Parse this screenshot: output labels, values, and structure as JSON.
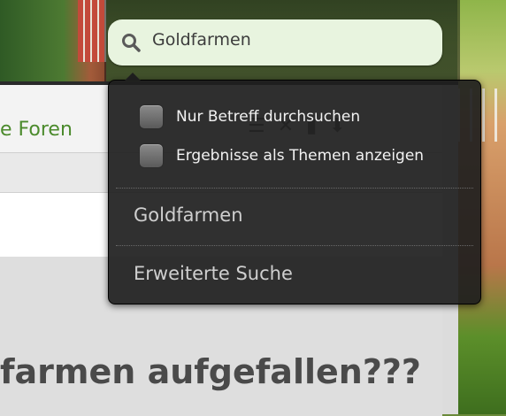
{
  "search": {
    "query": "Goldfarmen"
  },
  "dropdown": {
    "options": [
      {
        "label": "Nur Betreff durchsuchen",
        "checked": false
      },
      {
        "label": "Ergebnisse als Themen anzeigen",
        "checked": false
      }
    ],
    "recent_search": "Goldfarmen",
    "advanced_search": "Erweiterte Suche"
  },
  "forum": {
    "nav_link": "e Foren",
    "headline": "farmen aufgefallen???"
  },
  "colors": {
    "search_bg": "#e8f4df",
    "dropdown_bg": "#1e1e1e",
    "link_green": "#4b8a2c"
  },
  "icons": [
    "search-icon",
    "checkbox-icon",
    "list-icon",
    "close-icon",
    "bar-chart-icon",
    "arrow-down-icon"
  ]
}
